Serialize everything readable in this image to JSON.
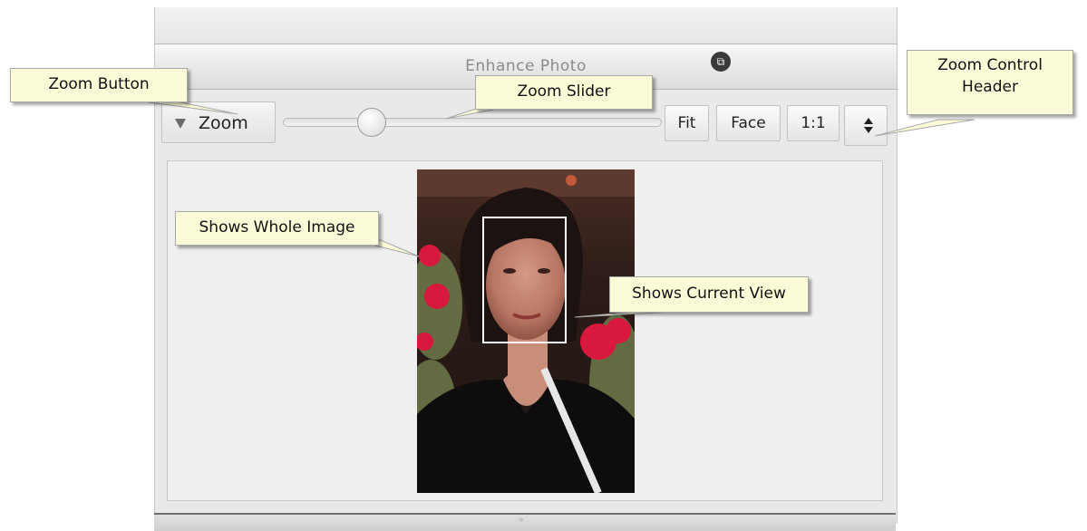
{
  "window": {
    "title": "Enhance Photo"
  },
  "toolbar": {
    "zoom_button_label": "Zoom",
    "zoom_slider_level": 0.2,
    "fit_label": "Fit",
    "face_label": "Face",
    "one_to_one_label": "1:1"
  },
  "icons": {
    "restore": "restore-window-icon",
    "zoom_toggle": "triangle-down-icon",
    "zoom_header": "up-down-arrows-icon",
    "bottom_grip": "grip-icon"
  },
  "callouts": {
    "zoom_button": "Zoom Button",
    "zoom_slider": "Zoom Slider",
    "zoom_control_header": "Zoom Control Header",
    "shows_whole_image": "Shows Whole Image",
    "shows_current_view": "Shows Current View"
  },
  "colors": {
    "callout_background": "#fcfbd7",
    "panel_background": "#e9e9e9",
    "flower_red": "#d8183c"
  }
}
